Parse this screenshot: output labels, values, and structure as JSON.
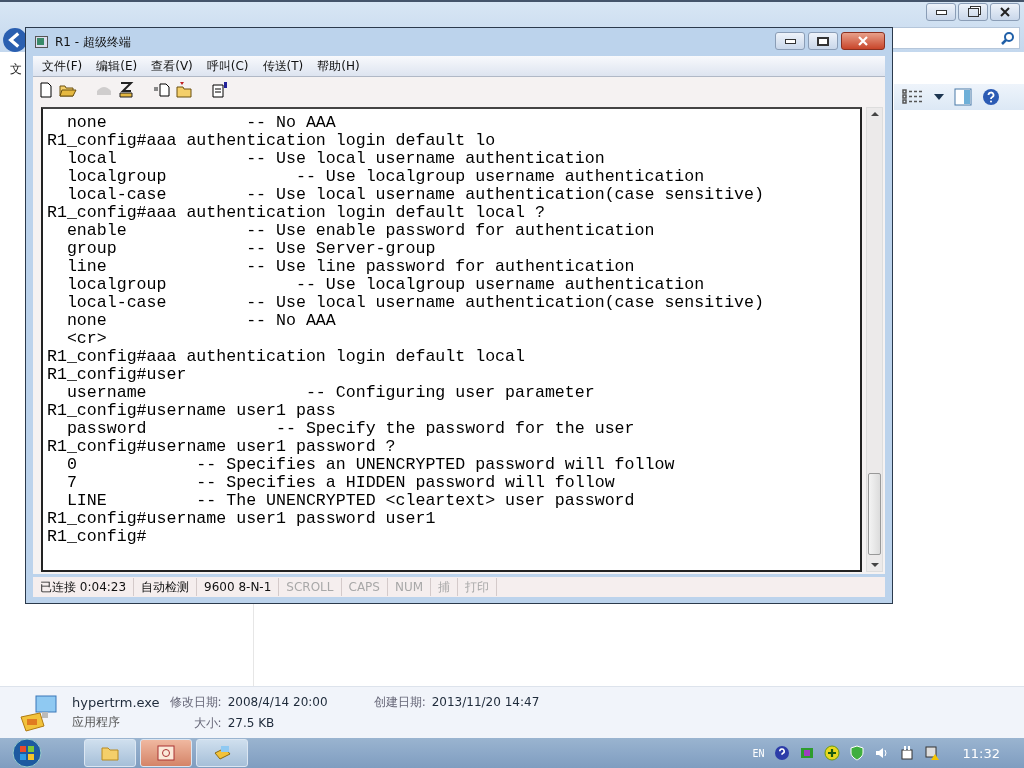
{
  "explorer": {
    "menu_fragment": "文",
    "details": {
      "file_name": "hypertrm.exe",
      "file_type": "应用程序",
      "fields": [
        {
          "label": "修改日期:",
          "value": "2008/4/14 20:00"
        },
        {
          "label": "大小:",
          "value": "27.5 KB"
        },
        {
          "label": "创建日期:",
          "value": "2013/11/20 14:47"
        }
      ]
    }
  },
  "window": {
    "title": "R1 - 超级终端"
  },
  "menu": [
    "文件(F)",
    "编辑(E)",
    "查看(V)",
    "呼叫(C)",
    "传送(T)",
    "帮助(H)"
  ],
  "toolbar": [
    {
      "kind": "new",
      "disabled": false
    },
    {
      "kind": "open",
      "disabled": false
    },
    {
      "kind": "call",
      "disabled": true
    },
    {
      "kind": "disconnect",
      "disabled": false
    },
    {
      "kind": "send",
      "disabled": false
    },
    {
      "kind": "receive",
      "disabled": false
    },
    {
      "kind": "properties",
      "disabled": false
    }
  ],
  "terminal": {
    "lines": [
      "  none              -- No AAA",
      "R1_config#aaa authentication login default lo",
      "  local             -- Use local username authentication",
      "  localgroup             -- Use localgroup username authentication",
      "  local-case        -- Use local username authentication(case sensitive)",
      "R1_config#aaa authentication login default local ?",
      "  enable            -- Use enable password for authentication",
      "  group             -- Use Server-group",
      "  line              -- Use line password for authentication",
      "  localgroup             -- Use localgroup username authentication",
      "  local-case        -- Use local username authentication(case sensitive)",
      "  none              -- No AAA",
      "  <cr>",
      "R1_config#aaa authentication login default local",
      "R1_config#user",
      "  username                -- Configuring user parameter",
      "R1_config#username user1 pass",
      "  password             -- Specify the password for the user",
      "R1_config#username user1 password ?",
      "  0            -- Specifies an UNENCRYPTED password will follow",
      "  7            -- Specifies a HIDDEN password will follow",
      "  LINE         -- The UNENCRYPTED <cleartext> user password",
      "R1_config#username user1 password user1",
      "R1_config#"
    ]
  },
  "status_bar": [
    {
      "text": "已连接 0:04:23",
      "disabled": false
    },
    {
      "text": "自动检测",
      "disabled": false
    },
    {
      "text": "9600 8-N-1",
      "disabled": false
    },
    {
      "text": "SCROLL",
      "disabled": true
    },
    {
      "text": "CAPS",
      "disabled": true
    },
    {
      "text": "NUM",
      "disabled": true
    },
    {
      "text": "捕",
      "disabled": true
    },
    {
      "text": "打印",
      "disabled": true
    }
  ],
  "tray": {
    "language": "EN",
    "clock": "11:32"
  }
}
